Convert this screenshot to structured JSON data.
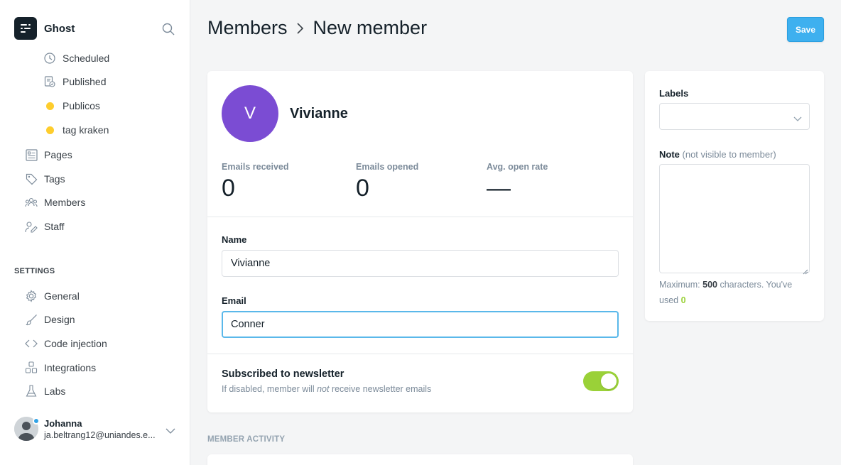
{
  "sidebar": {
    "brand_name": "Ghost",
    "posts_subitems": [
      {
        "label": "Scheduled",
        "icon": "clock-icon"
      },
      {
        "label": "Published",
        "icon": "published-icon"
      },
      {
        "label": "Publicos",
        "icon": "tag-dot-icon",
        "color": "#fecd2d"
      },
      {
        "label": "tag kraken",
        "icon": "tag-dot-icon",
        "color": "#fecd2d"
      }
    ],
    "items": [
      {
        "label": "Pages",
        "icon": "pages-icon"
      },
      {
        "label": "Tags",
        "icon": "tag-icon"
      },
      {
        "label": "Members",
        "icon": "members-icon"
      },
      {
        "label": "Staff",
        "icon": "staff-icon"
      }
    ],
    "settings_label": "SETTINGS",
    "settings_items": [
      {
        "label": "General",
        "icon": "gear-icon"
      },
      {
        "label": "Design",
        "icon": "brush-icon"
      },
      {
        "label": "Code injection",
        "icon": "code-icon"
      },
      {
        "label": "Integrations",
        "icon": "integrations-icon"
      },
      {
        "label": "Labs",
        "icon": "flask-icon"
      }
    ],
    "user": {
      "name": "Johanna",
      "email": "ja.beltrang12@uniandes.e..."
    }
  },
  "header": {
    "breadcrumb_parent": "Members",
    "breadcrumb_current": "New member",
    "save_label": "Save"
  },
  "member": {
    "avatar_initial": "V",
    "display_name": "Vivianne",
    "stats": [
      {
        "label": "Emails received",
        "value": "0"
      },
      {
        "label": "Emails opened",
        "value": "0"
      },
      {
        "label": "Avg. open rate",
        "value": "—"
      }
    ],
    "name_label": "Name",
    "name_value": "Vivianne",
    "email_label": "Email",
    "email_value": "Conner",
    "newsletter_title": "Subscribed to newsletter",
    "newsletter_desc_before": "If disabled, member will ",
    "newsletter_desc_em": "not",
    "newsletter_desc_after": " receive newsletter emails",
    "subscribed": true
  },
  "activity_label": "MEMBER ACTIVITY",
  "side": {
    "labels_label": "Labels",
    "note_label": "Note",
    "note_hint": "(not visible to member)",
    "note_value": "",
    "max_prefix": "Maximum: ",
    "max_count": "500",
    "max_suffix": " characters. You've used ",
    "used_count": "0"
  },
  "colors": {
    "accent": "#3eb0ef",
    "avatar": "#7b4cd3",
    "toggle_on": "#9ad138",
    "tag_dot": "#fecd2d"
  }
}
